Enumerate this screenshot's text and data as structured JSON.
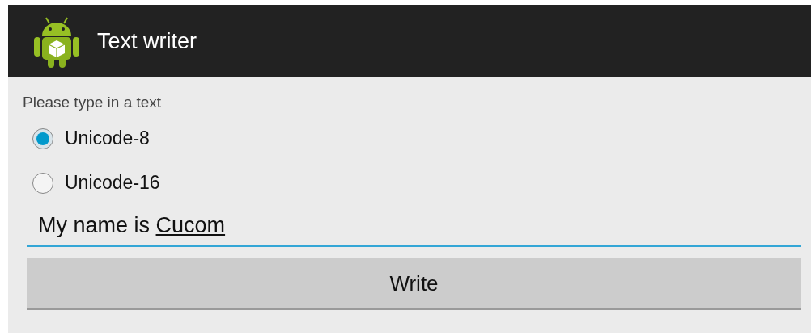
{
  "action_bar": {
    "title": "Text writer"
  },
  "prompt": "Please type in a text",
  "encodings": [
    {
      "label": "Unicode-8",
      "selected": true
    },
    {
      "label": "Unicode-16",
      "selected": false
    }
  ],
  "text_field": {
    "value": "My name is",
    "composing_word": "Cucom",
    "focused": true
  },
  "buttons": [
    {
      "label": "Write"
    }
  ]
}
